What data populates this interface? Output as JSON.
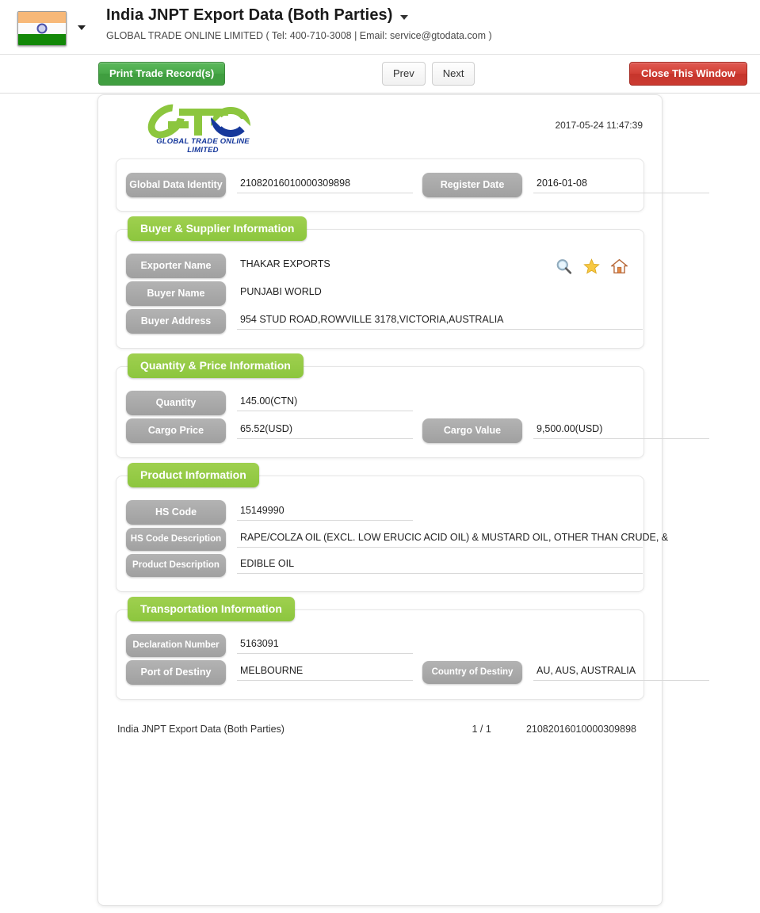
{
  "header": {
    "flag_icon": "india-flag-icon",
    "flag_caret_icon": "chevron-down-icon",
    "title": "India JNPT Export Data (Both Parties)",
    "title_caret_icon": "chevron-down-icon",
    "subtitle": "GLOBAL TRADE ONLINE LIMITED ( Tel: 400-710-3008 | Email: service@gtodata.com )"
  },
  "toolbar": {
    "print_label": "Print Trade Record(s)",
    "prev_label": "Prev",
    "next_label": "Next",
    "close_label": "Close This Window",
    "print_color": "#48a848",
    "close_color": "#cb3b31"
  },
  "sheet": {
    "logo_text": "GLOBAL TRADE  ONLINE LIMITED",
    "logo_green": "#8cc63e",
    "logo_blue": "#16389b",
    "timestamp": "2017-05-24 11:47:39"
  },
  "identity": {
    "id_label": "Global Data Identity",
    "id_value": "21082016010000309898",
    "date_label": "Register Date",
    "date_value": "2016-01-08"
  },
  "sections": {
    "buyer": {
      "title": "Buyer & Supplier Information",
      "exporter_label": "Exporter Name",
      "exporter_value": "THAKAR EXPORTS",
      "buyer_label": "Buyer Name",
      "buyer_value": "PUNJABI WORLD",
      "address_label": "Buyer Address",
      "address_value": "954 STUD ROAD,ROWVILLE 3178,VICTORIA,AUSTRALIA",
      "icons": {
        "search": "search-icon",
        "star": "star-icon",
        "home": "home-icon"
      }
    },
    "quantity": {
      "title": "Quantity & Price Information",
      "quantity_label": "Quantity",
      "quantity_value": "145.00(CTN)",
      "price_label": "Cargo Price",
      "price_value": "65.52(USD)",
      "cargo_value_label": "Cargo Value",
      "cargo_value_value": "9,500.00(USD)"
    },
    "product": {
      "title": "Product Information",
      "hs_label": "HS Code",
      "hs_value": "15149990",
      "hs_desc_label": "HS Code Description",
      "hs_desc_value": "RAPE/COLZA OIL (EXCL. LOW ERUCIC ACID OIL) & MUSTARD OIL, OTHER THAN CRUDE, &",
      "prod_desc_label": "Product Description",
      "prod_desc_value": "EDIBLE OIL"
    },
    "transport": {
      "title": "Transportation Information",
      "decl_label": "Declaration Number",
      "decl_value": "5163091",
      "port_label": "Port of Destiny",
      "port_value": "MELBOURNE",
      "country_label": "Country of Destiny",
      "country_value": "AU, AUS, AUSTRALIA"
    }
  },
  "footer": {
    "left": "India JNPT Export Data (Both Parties)",
    "page": "1 / 1",
    "right": "21082016010000309898"
  },
  "theme": {
    "section_green": "#8cc63e",
    "label_gray": "#a0a0a0"
  }
}
